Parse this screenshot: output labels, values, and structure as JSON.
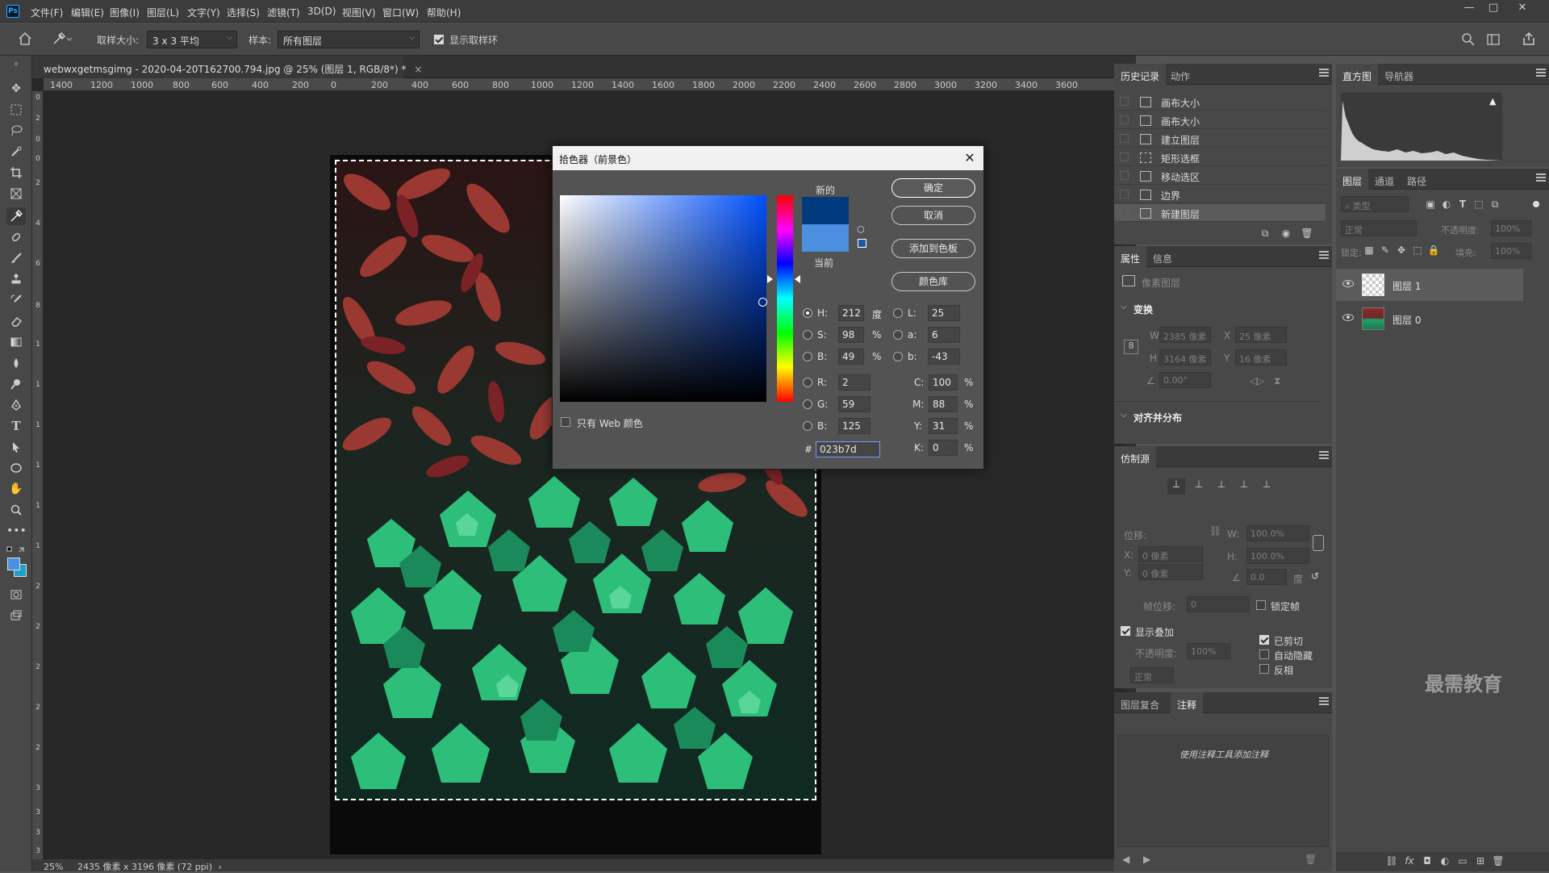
{
  "app": {
    "logo": "Ps"
  },
  "menu": [
    "文件(F)",
    "编辑(E)",
    "图像(I)",
    "图层(L)",
    "文字(Y)",
    "选择(S)",
    "滤镜(T)",
    "3D(D)",
    "视图(V)",
    "窗口(W)",
    "帮助(H)"
  ],
  "window_controls": {
    "minimize": "—",
    "maximize": "□",
    "close": "✕"
  },
  "options_bar": {
    "sample_size_label": "取样大小:",
    "sample_size_value": "3 x 3 平均",
    "sample_label": "样本:",
    "sample_value": "所有图层",
    "show_ring_label": "显示取样环",
    "show_ring_checked": true
  },
  "document": {
    "tab_title": "webwxgetmsgimg - 2020-04-20T162700.794.jpg @ 25% (图层 1, RGB/8*) *",
    "tab_close": "×",
    "ruler_h": [
      "1400",
      "1200",
      "1000",
      "800",
      "600",
      "400",
      "200",
      "0",
      "200",
      "400",
      "600",
      "800",
      "1000",
      "1200",
      "1400",
      "1600",
      "1800",
      "2000",
      "2200",
      "2400",
      "2600",
      "2800",
      "3000",
      "3200",
      "3400",
      "3600"
    ],
    "ruler_v": [
      "0",
      "2",
      "0",
      "0",
      "2",
      "4",
      "6",
      "8",
      "1",
      "1",
      "1",
      "1",
      "1",
      "1",
      "2",
      "2",
      "2",
      "2",
      "2",
      "3",
      "3",
      "3",
      "3"
    ],
    "zoom": "25%",
    "status": "2435 像素 x 3196 像素 (72 ppi)",
    "status_arrow": "›"
  },
  "color_picker": {
    "title": "拾色器（前景色）",
    "close": "✕",
    "new_label": "新的",
    "current_label": "当前",
    "new_color": "#023b7d",
    "current_color": "#4a8fe0",
    "buttons": {
      "ok": "确定",
      "cancel": "取消",
      "add_swatch": "添加到色板",
      "libraries": "颜色库"
    },
    "web_only_label": "只有 Web 颜色",
    "hsb": {
      "h_label": "H:",
      "h": "212",
      "h_unit": "度",
      "s_label": "S:",
      "s": "98",
      "s_unit": "%",
      "b_label": "B:",
      "b": "49",
      "b_unit": "%"
    },
    "lab": {
      "l_label": "L:",
      "l": "25",
      "a_label": "a:",
      "a": "6",
      "b_label": "b:",
      "b": "-43"
    },
    "rgb": {
      "r_label": "R:",
      "r": "2",
      "g_label": "G:",
      "g": "59",
      "b_label": "B:",
      "b": "125"
    },
    "cmyk": {
      "c_label": "C:",
      "c": "100",
      "m_label": "M:",
      "m": "88",
      "y_label": "Y:",
      "y": "31",
      "k_label": "K:",
      "k": "0",
      "unit": "%"
    },
    "hex_label": "#",
    "hex": "023b7d"
  },
  "history_panel": {
    "tabs": [
      "历史记录",
      "动作"
    ],
    "items": [
      "画布大小",
      "画布大小",
      "建立图层",
      "矩形选框",
      "移动选区",
      "边界",
      "新建图层"
    ]
  },
  "properties_panel": {
    "tabs": [
      "属性",
      "信息"
    ],
    "pixel_layer": "像素图层",
    "transform_title": "变换",
    "w_label": "W",
    "w_value": "2385 像素",
    "x_label": "X",
    "x_value": "25 像素",
    "h_label": "H",
    "h_value": "3164 像素",
    "y_label": "Y",
    "y_value": "16 像素",
    "angle_value": "0.00°",
    "align_title": "对齐并分布"
  },
  "clone_panel": {
    "tab": "仿制源",
    "offset_label": "位移:",
    "x_label": "X:",
    "x_value": "0 像素",
    "y_label": "Y:",
    "y_value": "0 像素",
    "w_label": "W:",
    "w_value": "100.0%",
    "h_label": "H:",
    "h_value": "100.0%",
    "angle_value": "0.0",
    "angle_unit": "度",
    "frame_offset_label": "帧位移:",
    "frame_offset_value": "0",
    "lock_frame_label": "锁定帧",
    "show_overlay_label": "显示叠加",
    "opacity_label": "不透明度:",
    "opacity_value": "100%",
    "blend_value": "正常",
    "clipped_label": "已剪切",
    "auto_hide_label": "自动隐藏",
    "invert_label": "反相"
  },
  "notes_panel": {
    "tabs": [
      "图层复合",
      "注释"
    ],
    "hint": "使用注释工具添加注释"
  },
  "histogram_panel": {
    "tabs": [
      "直方图",
      "导航器"
    ]
  },
  "layers_panel": {
    "tabs": [
      "图层",
      "通道",
      "路径"
    ],
    "search_placeholder": "类型",
    "blend_mode": "正常",
    "opacity_label": "不透明度:",
    "opacity_value": "100%",
    "lock_label": "锁定:",
    "fill_label": "填充:",
    "fill_value": "100%",
    "layers": [
      "图层 1",
      "图层 0"
    ]
  },
  "watermark": "最需教育"
}
